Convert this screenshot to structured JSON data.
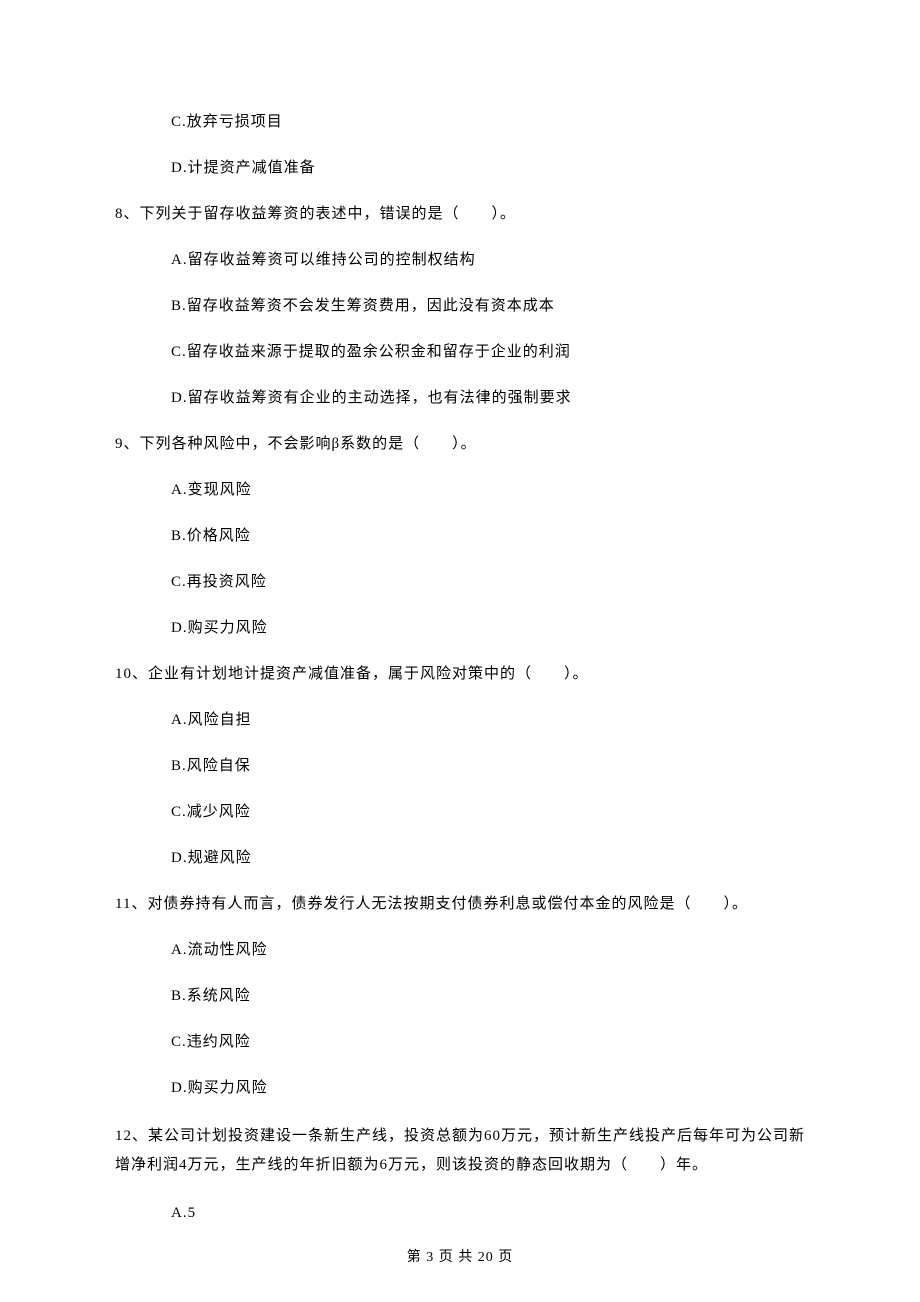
{
  "q7_options": {
    "c": "C.放弃亏损项目",
    "d": "D.计提资产减值准备"
  },
  "q8": {
    "stem": "8、下列关于留存收益筹资的表述中，错误的是（　　）。",
    "a": "A.留存收益筹资可以维持公司的控制权结构",
    "b": "B.留存收益筹资不会发生筹资费用，因此没有资本成本",
    "c": "C.留存收益来源于提取的盈余公积金和留存于企业的利润",
    "d": "D.留存收益筹资有企业的主动选择，也有法律的强制要求"
  },
  "q9": {
    "stem": "9、下列各种风险中，不会影响β系数的是（　　）。",
    "a": "A.变现风险",
    "b": "B.价格风险",
    "c": "C.再投资风险",
    "d": "D.购买力风险"
  },
  "q10": {
    "stem": "10、企业有计划地计提资产减值准备，属于风险对策中的（　　）。",
    "a": "A.风险自担",
    "b": "B.风险自保",
    "c": "C.减少风险",
    "d": "D.规避风险"
  },
  "q11": {
    "stem": "11、对债券持有人而言，债券发行人无法按期支付债券利息或偿付本金的风险是（　　）。",
    "a": "A.流动性风险",
    "b": "B.系统风险",
    "c": "C.违约风险",
    "d": "D.购买力风险"
  },
  "q12": {
    "stem": "12、某公司计划投资建设一条新生产线，投资总额为60万元，预计新生产线投产后每年可为公司新增净利润4万元，生产线的年折旧额为6万元，则该投资的静态回收期为（　　）年。",
    "a": "A.5"
  },
  "footer": "第 3 页 共 20 页"
}
